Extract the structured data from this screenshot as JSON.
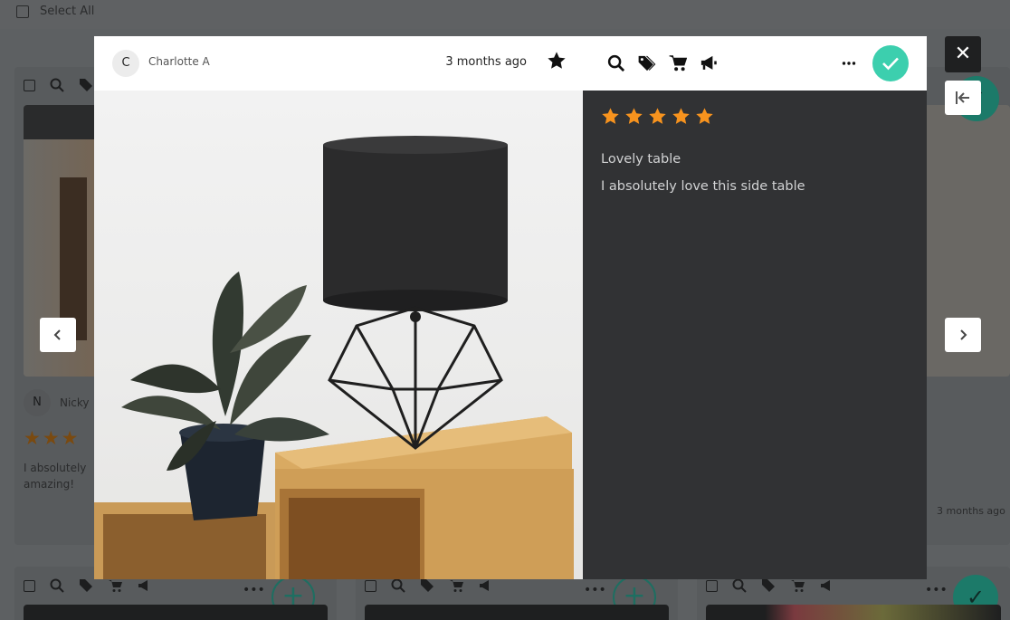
{
  "page": {
    "select_all_label": "Select All"
  },
  "background_cards": {
    "avatar_initial": "N",
    "author": "Nicky",
    "text_line1": "I absolutely",
    "text_line2": "amazing!",
    "right_time": "3 months ago"
  },
  "modal": {
    "author_initial": "C",
    "author_name": "Charlotte A",
    "time_ago": "3 months ago",
    "rating": 5,
    "review_title": "Lovely table",
    "review_body": "I absolutely love this side table",
    "toolbar_icons": [
      "search-icon",
      "tag-icon",
      "cart-icon",
      "megaphone-icon"
    ],
    "accent_color": "#3ccfae",
    "star_color": "#f7931e"
  }
}
